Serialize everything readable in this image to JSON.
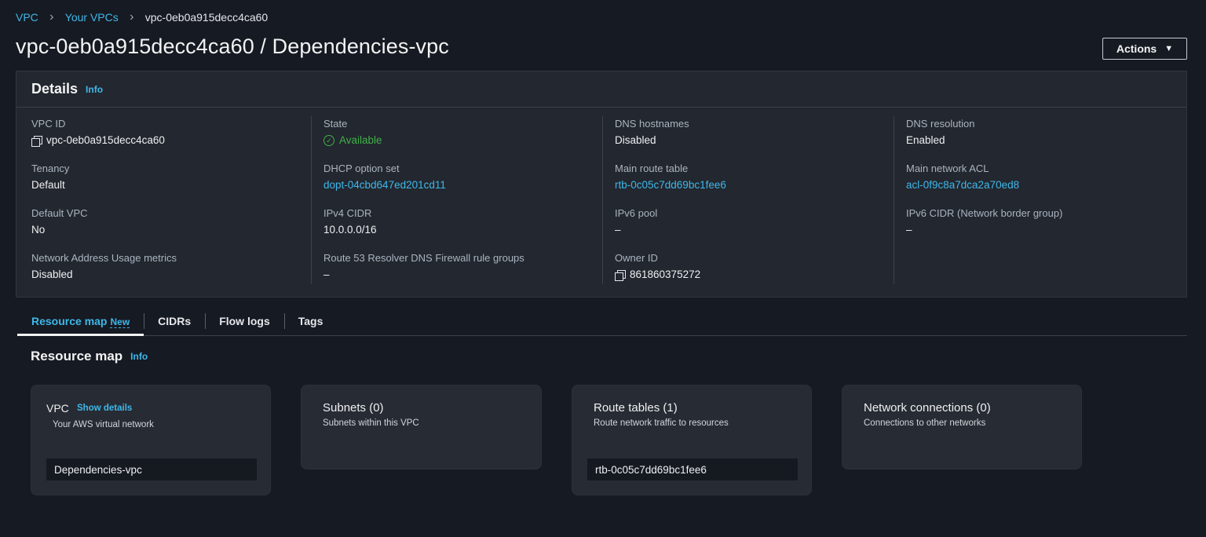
{
  "breadcrumb": {
    "items": [
      "VPC",
      "Your VPCs"
    ],
    "current": "vpc-0eb0a915decc4ca60"
  },
  "page_title": "vpc-0eb0a915decc4ca60 / Dependencies-vpc",
  "actions_label": "Actions",
  "details": {
    "title": "Details",
    "info": "Info",
    "vpc_id": {
      "label": "VPC ID",
      "value": "vpc-0eb0a915decc4ca60"
    },
    "tenancy": {
      "label": "Tenancy",
      "value": "Default"
    },
    "default_vpc": {
      "label": "Default VPC",
      "value": "No"
    },
    "nau_metrics": {
      "label": "Network Address Usage metrics",
      "value": "Disabled"
    },
    "state": {
      "label": "State",
      "value": "Available"
    },
    "dhcp": {
      "label": "DHCP option set",
      "value": "dopt-04cbd647ed201cd11"
    },
    "ipv4_cidr": {
      "label": "IPv4 CIDR",
      "value": "10.0.0.0/16"
    },
    "r53_firewall": {
      "label": "Route 53 Resolver DNS Firewall rule groups",
      "value": "–"
    },
    "dns_hostnames": {
      "label": "DNS hostnames",
      "value": "Disabled"
    },
    "main_route_table": {
      "label": "Main route table",
      "value": "rtb-0c05c7dd69bc1fee6"
    },
    "ipv6_pool": {
      "label": "IPv6 pool",
      "value": "–"
    },
    "owner_id": {
      "label": "Owner ID",
      "value": "861860375272"
    },
    "dns_resolution": {
      "label": "DNS resolution",
      "value": "Enabled"
    },
    "main_acl": {
      "label": "Main network ACL",
      "value": "acl-0f9c8a7dca2a70ed8"
    },
    "ipv6_cidr": {
      "label": "IPv6 CIDR (Network border group)",
      "value": "–"
    }
  },
  "tabs": [
    {
      "label": "Resource map",
      "badge": "New"
    },
    {
      "label": "CIDRs"
    },
    {
      "label": "Flow logs"
    },
    {
      "label": "Tags"
    }
  ],
  "resource_map": {
    "title": "Resource map",
    "info": "Info",
    "vpc_card": {
      "title": "VPC",
      "show_details": "Show details",
      "subtitle": "Your AWS virtual network",
      "item": "Dependencies-vpc"
    },
    "subnets_card": {
      "title": "Subnets (0)",
      "subtitle": "Subnets within this VPC"
    },
    "route_tables_card": {
      "title": "Route tables (1)",
      "subtitle": "Route network traffic to resources",
      "item": "rtb-0c05c7dd69bc1fee6"
    },
    "network_card": {
      "title": "Network connections (0)",
      "subtitle": "Connections to other networks"
    }
  },
  "colors": {
    "background": "#161a22",
    "panel": "#23272f",
    "link": "#3eb8ea",
    "success": "#3fb148"
  },
  "icons": [
    "chevron-right-icon",
    "copy-icon",
    "check-circle-icon",
    "caret-down-icon"
  ]
}
